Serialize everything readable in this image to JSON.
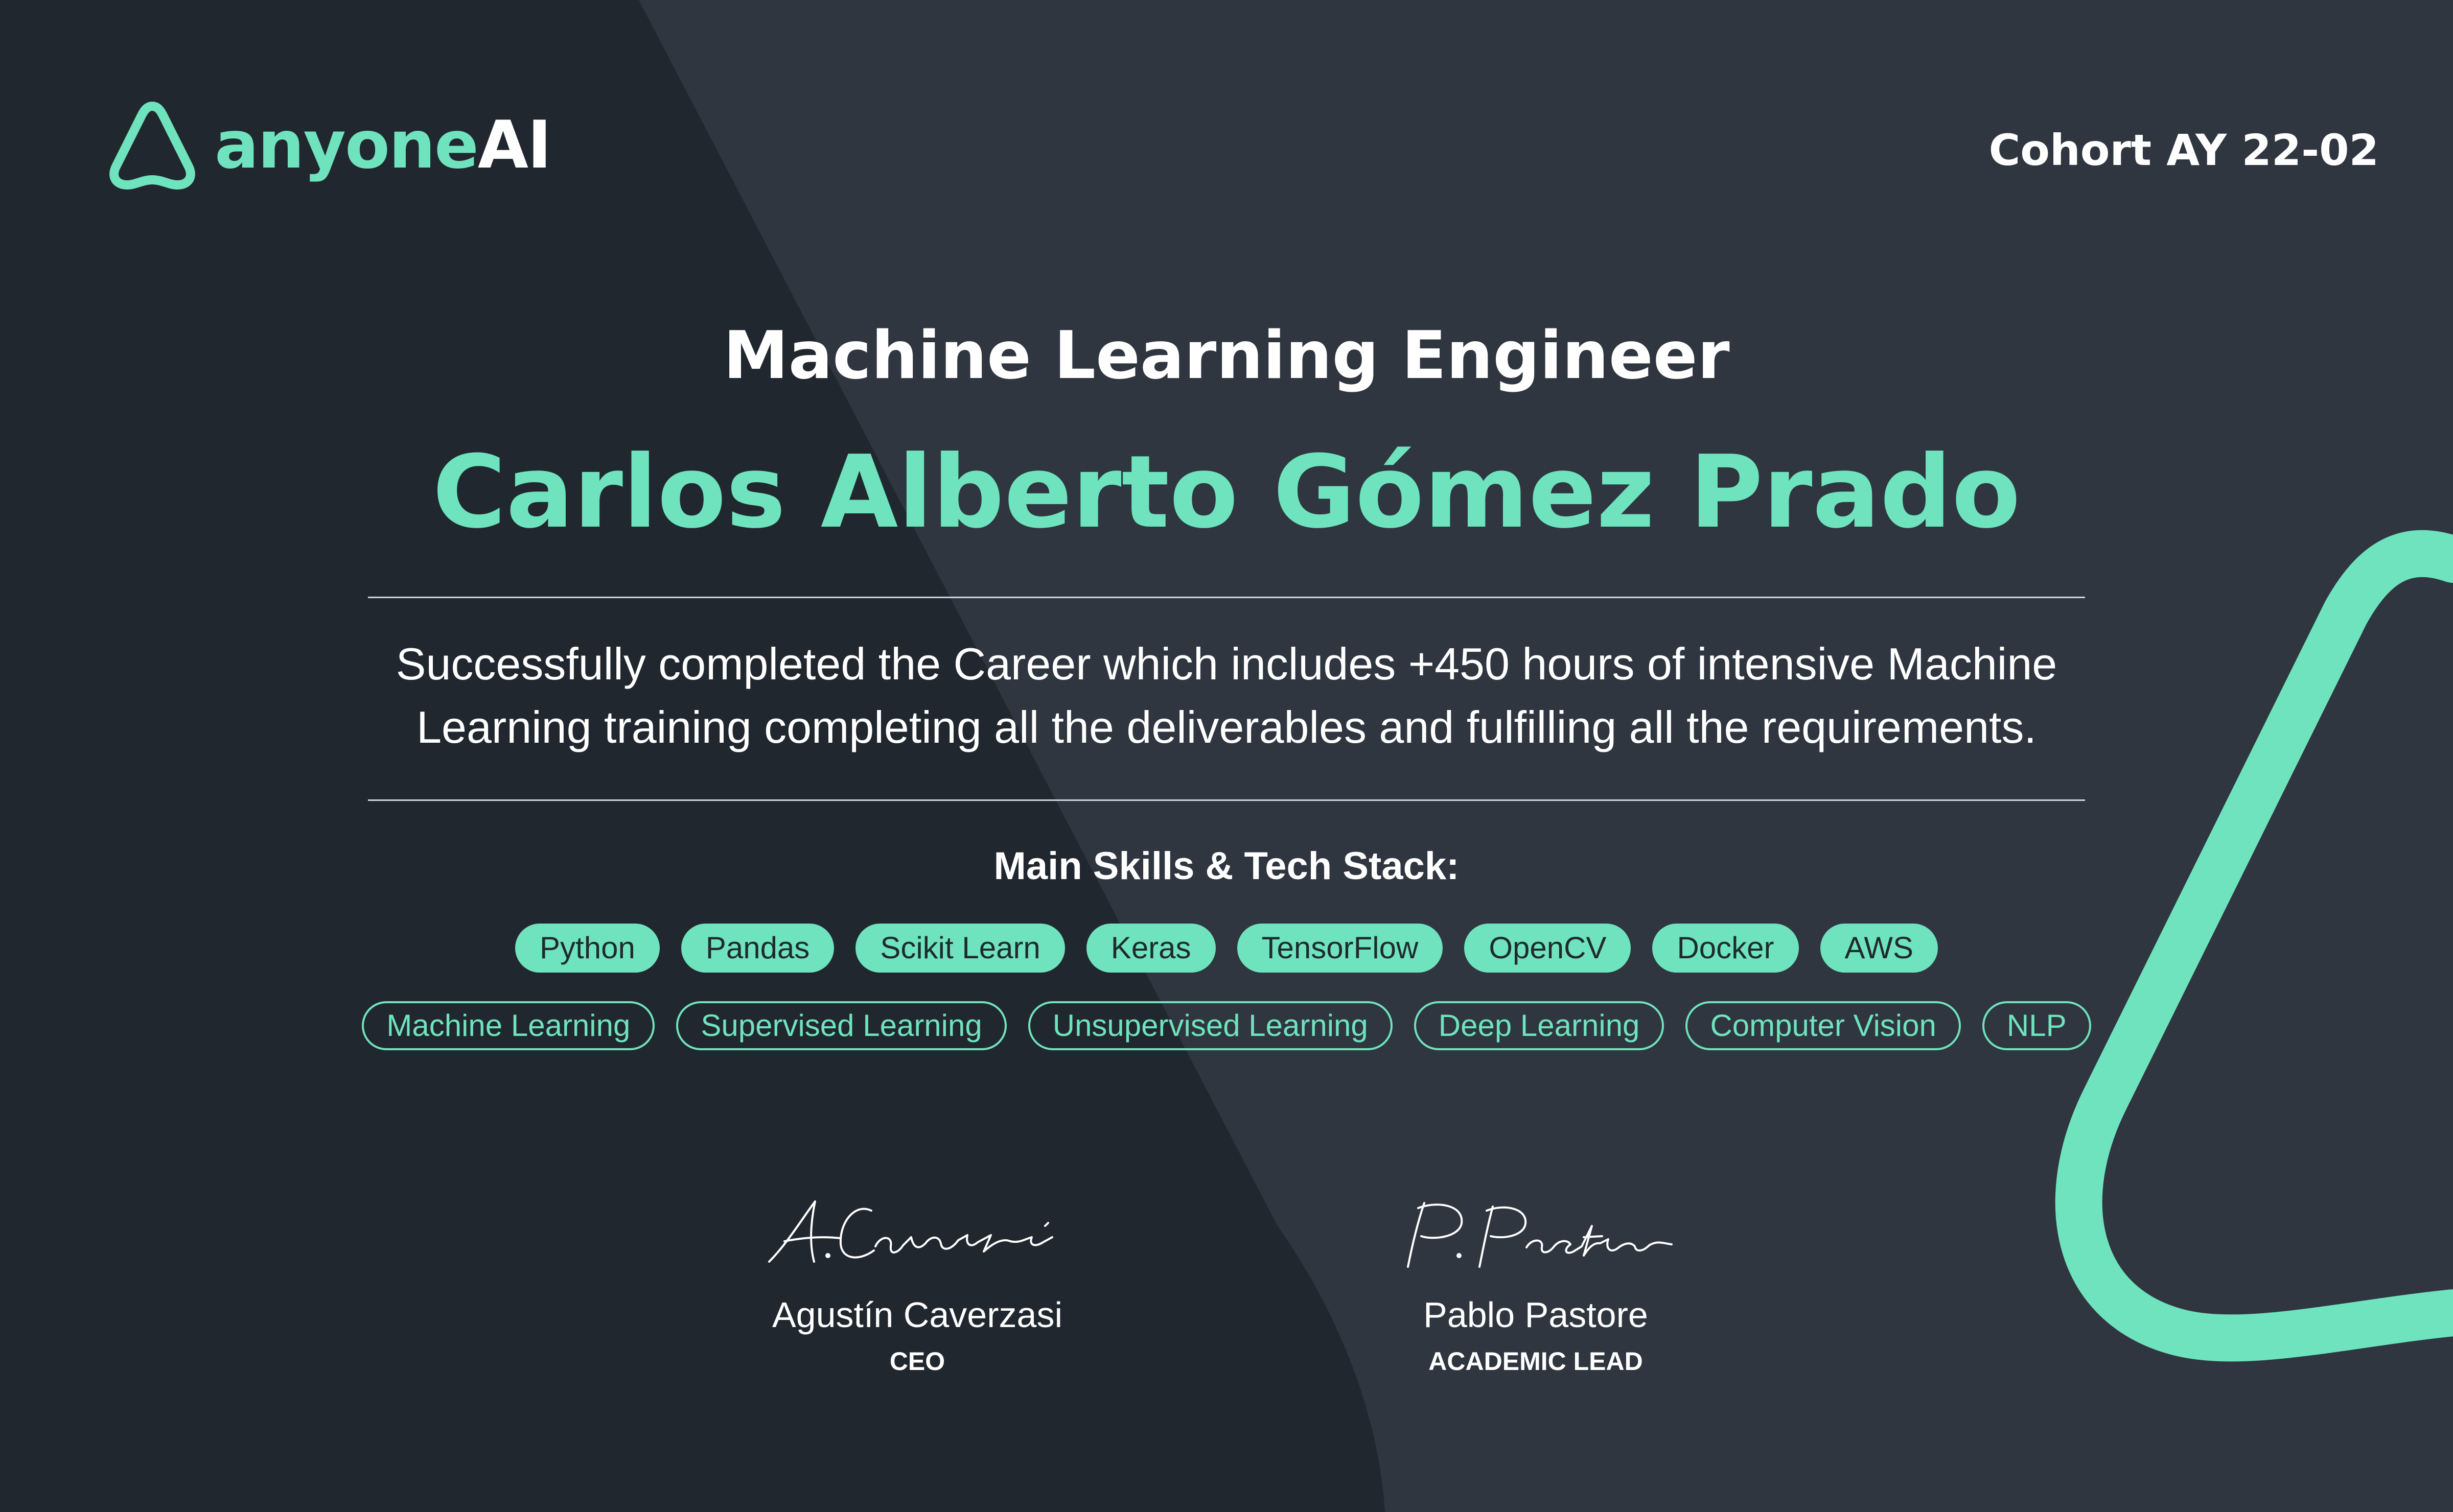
{
  "brand": {
    "name_part1": "anyone",
    "name_part2": "AI",
    "accent_color": "#6fe3bd",
    "background_color": "#21272f"
  },
  "cohort": "Cohort AY 22-02",
  "career_title": "Machine Learning Engineer",
  "recipient_name": "Carlos Alberto Gómez Prado",
  "description": "Successfully completed the Career which includes +450 hours of intensive Machine Learning training completing all the deliverables and fulfilling all the requirements.",
  "skills_title": "Main Skills & Tech Stack:",
  "tech_stack": [
    "Python",
    "Pandas",
    "Scikit Learn",
    "Keras",
    "TensorFlow",
    "OpenCV",
    "Docker",
    "AWS"
  ],
  "skills": [
    "Machine Learning",
    "Supervised Learning",
    "Unsupervised Learning",
    "Deep Learning",
    "Computer Vision",
    "NLP"
  ],
  "signatories": [
    {
      "signature": "A. Caverzasi",
      "name": "Agustín Caverzasi",
      "role": "CEO"
    },
    {
      "signature": "P. Pastore",
      "name": "Pablo Pastore",
      "role": "ACADEMIC LEAD"
    }
  ]
}
